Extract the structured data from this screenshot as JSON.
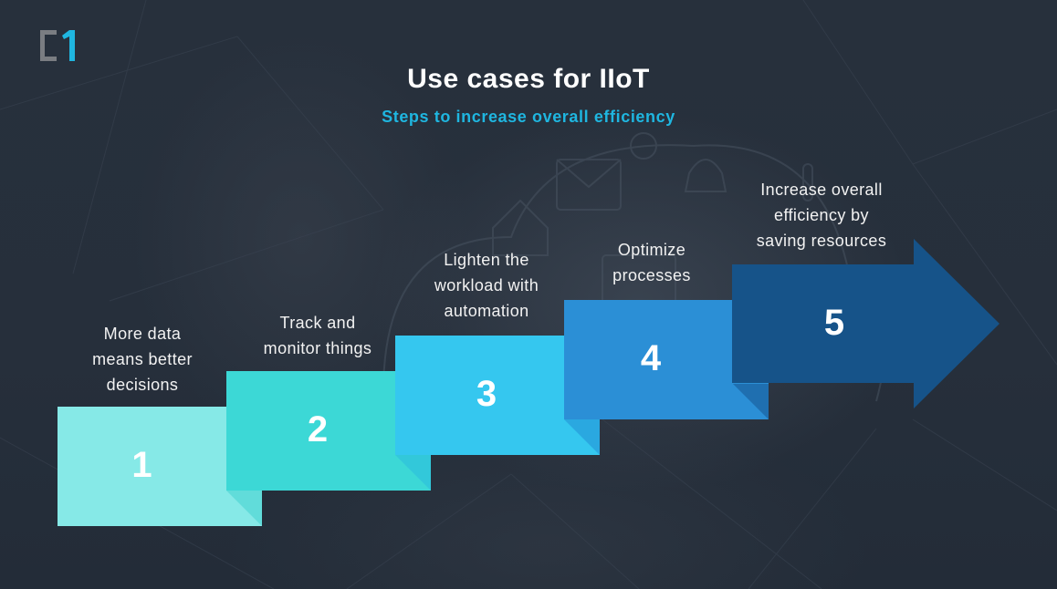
{
  "logo": {
    "text": "C1",
    "bracket_color": "#7a7d82",
    "one_color": "#1fb6e0"
  },
  "header": {
    "title": "Use cases for IIoT",
    "subtitle": "Steps to increase overall efficiency"
  },
  "steps": [
    {
      "number": "1",
      "label_lines": [
        "More data",
        "means better",
        "decisions"
      ],
      "color": "#86e9e7",
      "fold_color": "#61dcda"
    },
    {
      "number": "2",
      "label_lines": [
        "Track and",
        "monitor things"
      ],
      "color": "#3cd8d6",
      "fold_color": "#32c8da"
    },
    {
      "number": "3",
      "label_lines": [
        "Lighten the",
        "workload with",
        "automation"
      ],
      "color": "#35c7ef",
      "fold_color": "#2aa8e0"
    },
    {
      "number": "4",
      "label_lines": [
        "Optimize",
        "processes"
      ],
      "color": "#2b8fd6",
      "fold_color": "#1f6fb0"
    },
    {
      "number": "5",
      "label_lines": [
        "Increase overall",
        "efficiency by",
        "saving resources"
      ],
      "color": "#165389"
    }
  ]
}
